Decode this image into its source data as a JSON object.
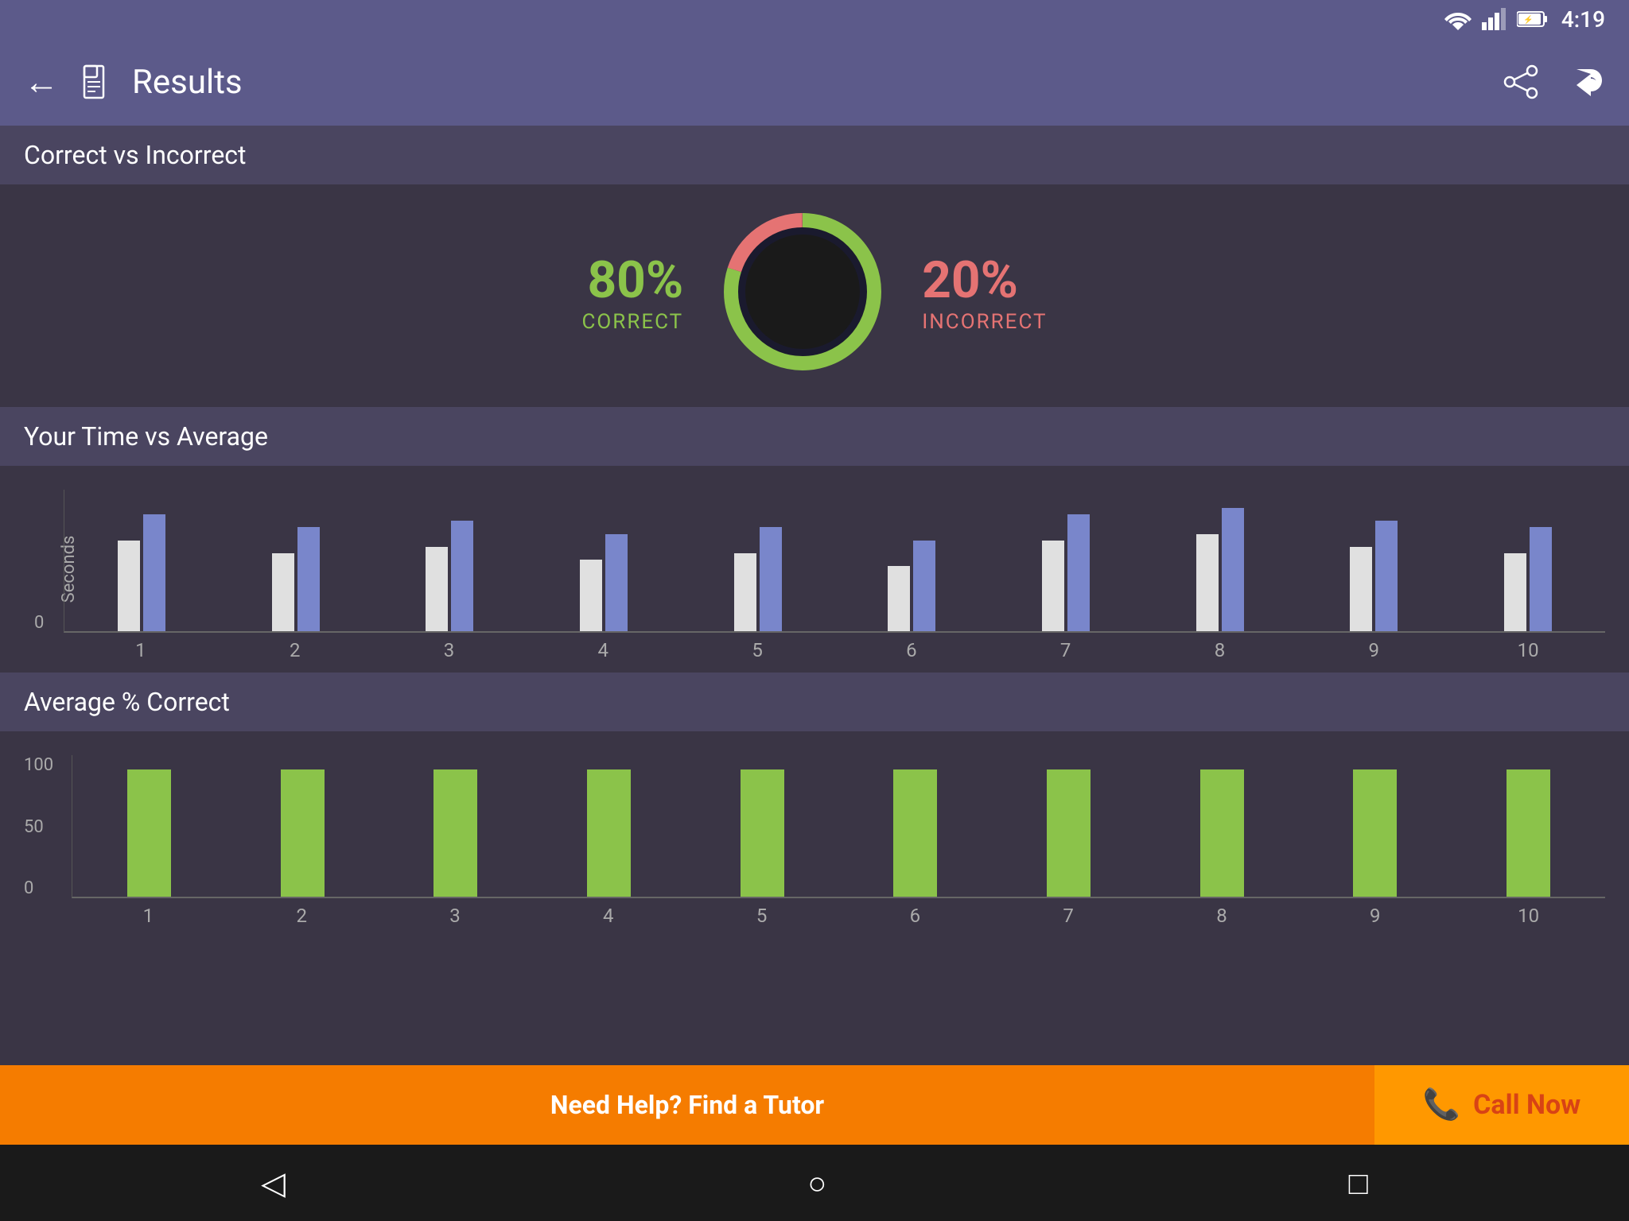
{
  "statusBar": {
    "time": "4:19"
  },
  "appBar": {
    "title": "Results",
    "backLabel": "←",
    "shareLabel": "share",
    "replyLabel": "reply"
  },
  "correctVsIncorrect": {
    "sectionTitle": "Correct vs Incorrect",
    "correctPct": "80%",
    "correctLabel": "CORRECT",
    "incorrectPct": "20%",
    "incorrectLabel": "INCORRECT",
    "donutGreenDeg": 288,
    "donutRedDeg": 72
  },
  "timeVsAverage": {
    "sectionTitle": "Your Time vs Average",
    "yAxisLabel": "Seconds",
    "xLabels": [
      "1",
      "2",
      "3",
      "4",
      "5",
      "6",
      "7",
      "8",
      "9",
      "10"
    ],
    "yourTimeBars": [
      70,
      60,
      65,
      55,
      60,
      50,
      70,
      75,
      65,
      60
    ],
    "avgTimeBars": [
      90,
      80,
      85,
      75,
      80,
      70,
      90,
      95,
      85,
      80
    ]
  },
  "avgCorrect": {
    "sectionTitle": "Average % Correct",
    "yLabels": [
      "100",
      "50",
      "0"
    ],
    "xLabels": [
      "1",
      "2",
      "3",
      "4",
      "5",
      "6",
      "7",
      "8",
      "9",
      "10"
    ],
    "bars": [
      100,
      100,
      100,
      100,
      100,
      100,
      100,
      100,
      100,
      100
    ]
  },
  "bottomBanner": {
    "helpText": "Need Help? Find a Tutor",
    "callNow": "Call Now"
  },
  "navBar": {
    "back": "◁",
    "home": "○",
    "recents": "□"
  }
}
